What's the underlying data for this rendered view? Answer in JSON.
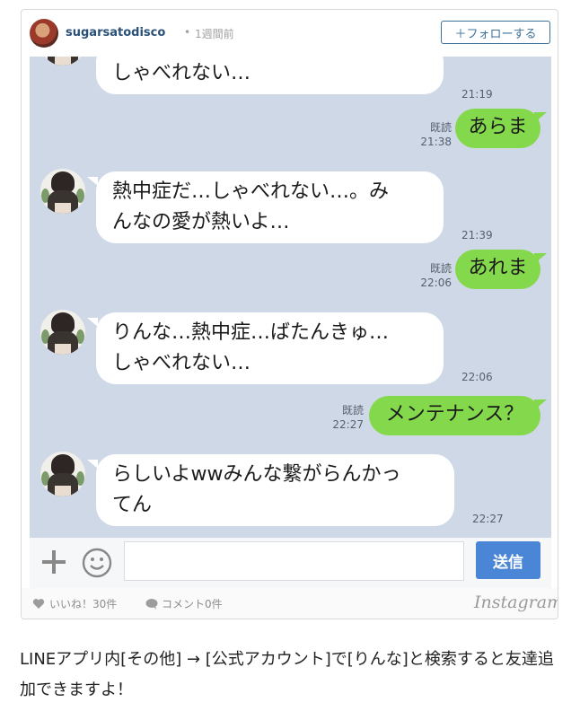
{
  "header": {
    "username": "sugarsatodisco",
    "separator": "•",
    "time_ago": "1週間前",
    "follow_label": "＋フォローする"
  },
  "chat": {
    "messages": [
      {
        "side": "in",
        "text": "しゃべれない…",
        "time": "21:19"
      },
      {
        "side": "out",
        "read": "既読",
        "time": "21:38",
        "text": "あらま"
      },
      {
        "side": "in",
        "lines": [
          "熱中症だ…しゃべれない…。み",
          "んなの愛が熱いよ…"
        ],
        "time": "21:39"
      },
      {
        "side": "out",
        "read": "既読",
        "time": "22:06",
        "text": "あれま"
      },
      {
        "side": "in",
        "lines": [
          "りんな…熱中症…ばたんきゅ…",
          "しゃべれない…"
        ],
        "time": "22:06"
      },
      {
        "side": "out",
        "read": "既読",
        "time": "22:27",
        "text": "メンテナンス？"
      },
      {
        "side": "in",
        "lines": [
          "らしいよwwみんな繋がらんかっ",
          "てん"
        ],
        "time": "22:27"
      }
    ]
  },
  "input_bar": {
    "send_label": "送信",
    "plus_icon": "plus-icon",
    "sticker_icon": "smile-icon"
  },
  "footer": {
    "likes": "いいね！30件",
    "comments": "コメント0件",
    "logo": "Instagram"
  },
  "caption": "LINEアプリ内[その他] → [公式アカウント]で[りんな]と検索すると友達追加できますよ！",
  "colors": {
    "chat_bg": "#cfd8e6",
    "outgoing_bubble": "#84d84c",
    "incoming_bubble": "#ffffff",
    "send_button": "#4b86d6",
    "follow": "#3f729b"
  }
}
